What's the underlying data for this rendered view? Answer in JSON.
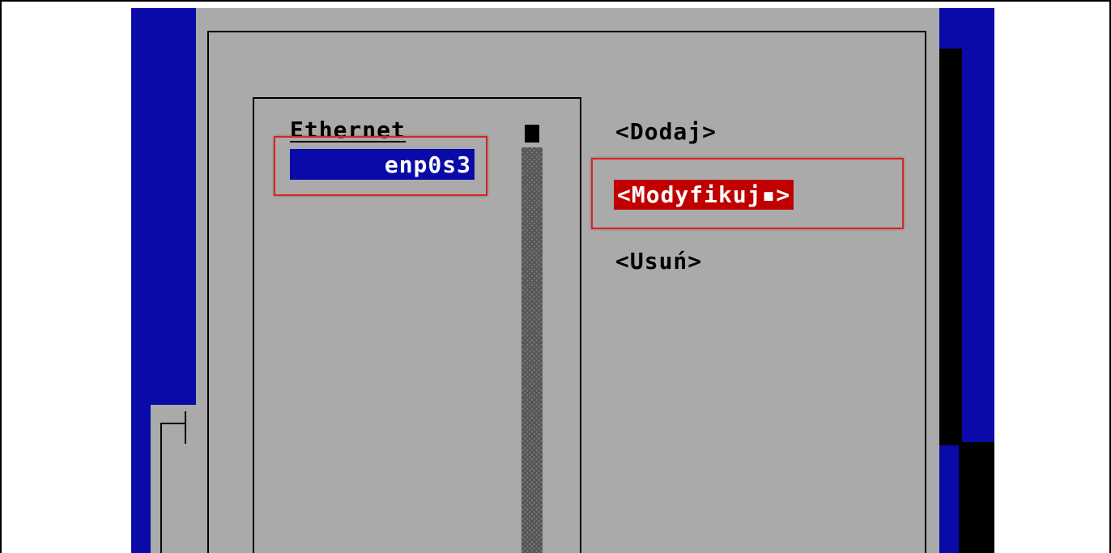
{
  "list": {
    "category_label": "Ethernet",
    "items": [
      "enp0s3"
    ]
  },
  "buttons": {
    "add_label": "<Dodaj>",
    "edit_label": "<Modyfikuj▪>",
    "delete_label": "<Usuń>"
  },
  "colors": {
    "terminal_background": "#0a0aa8",
    "dialog_background": "#aaaaaa",
    "selected_button": "#c00000",
    "annotation_highlight": "#e02020"
  },
  "icons": {
    "scrollbar_thumb": "scrollbar-thumb-icon"
  }
}
